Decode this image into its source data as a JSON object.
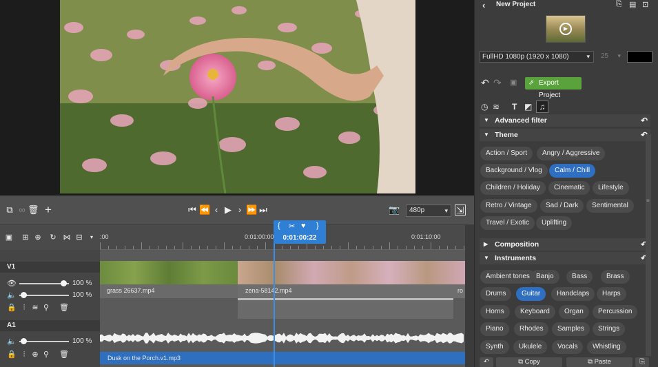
{
  "project": {
    "back_label": "‹",
    "title": "New Project"
  },
  "settings": {
    "resolution": "FullHD 1080p (1920 x 1080)",
    "fps": "25",
    "background_color": "#000000"
  },
  "toolbar": {
    "export_label": "Export Project"
  },
  "transport": {
    "preview_quality": "480p"
  },
  "timeline": {
    "ruler_labels": [
      ":00",
      "0:01:00:00",
      "0:01:10:00"
    ],
    "playhead_time": "0:01:00:22",
    "tracks": {
      "v1": {
        "name": "V1",
        "volume": "100 %",
        "speed": "100 %",
        "clips": [
          "grass 26637.mp4",
          "zena-58142.mp4",
          "ro"
        ]
      },
      "a1": {
        "name": "A1",
        "volume": "100 %",
        "clips": [
          "Dusk on the Porch.v1.mp3"
        ]
      }
    }
  },
  "panel": {
    "sections": {
      "advanced_filter": "Advanced filter",
      "theme": "Theme",
      "composition": "Composition",
      "instruments": "Instruments"
    },
    "theme_chips": [
      "Action / Sport",
      "Angry / Aggressive",
      "Background / Vlog",
      "Calm / Chill",
      "Children / Holiday",
      "Cinematic",
      "Lifestyle",
      "Retro / Vintage",
      "Sad / Dark",
      "Sentimental",
      "Travel / Exotic",
      "Uplifting"
    ],
    "instrument_chips": [
      "Ambient tones",
      "Banjo",
      "Bass",
      "Brass",
      "Drums",
      "Guitar",
      "Handclaps",
      "Harps",
      "Horns",
      "Keyboard",
      "Organ",
      "Percussion",
      "Piano",
      "Rhodes",
      "Samples",
      "Strings",
      "Synth",
      "Ukulele",
      "Vocals",
      "Whistling"
    ],
    "bottom": {
      "copy": "Copy",
      "paste": "Paste"
    }
  },
  "colors": {
    "accent": "#2e6fc2",
    "export": "#5aa33c",
    "playhead": "#2f7fd4",
    "audio_track": "#2f6fbf"
  }
}
